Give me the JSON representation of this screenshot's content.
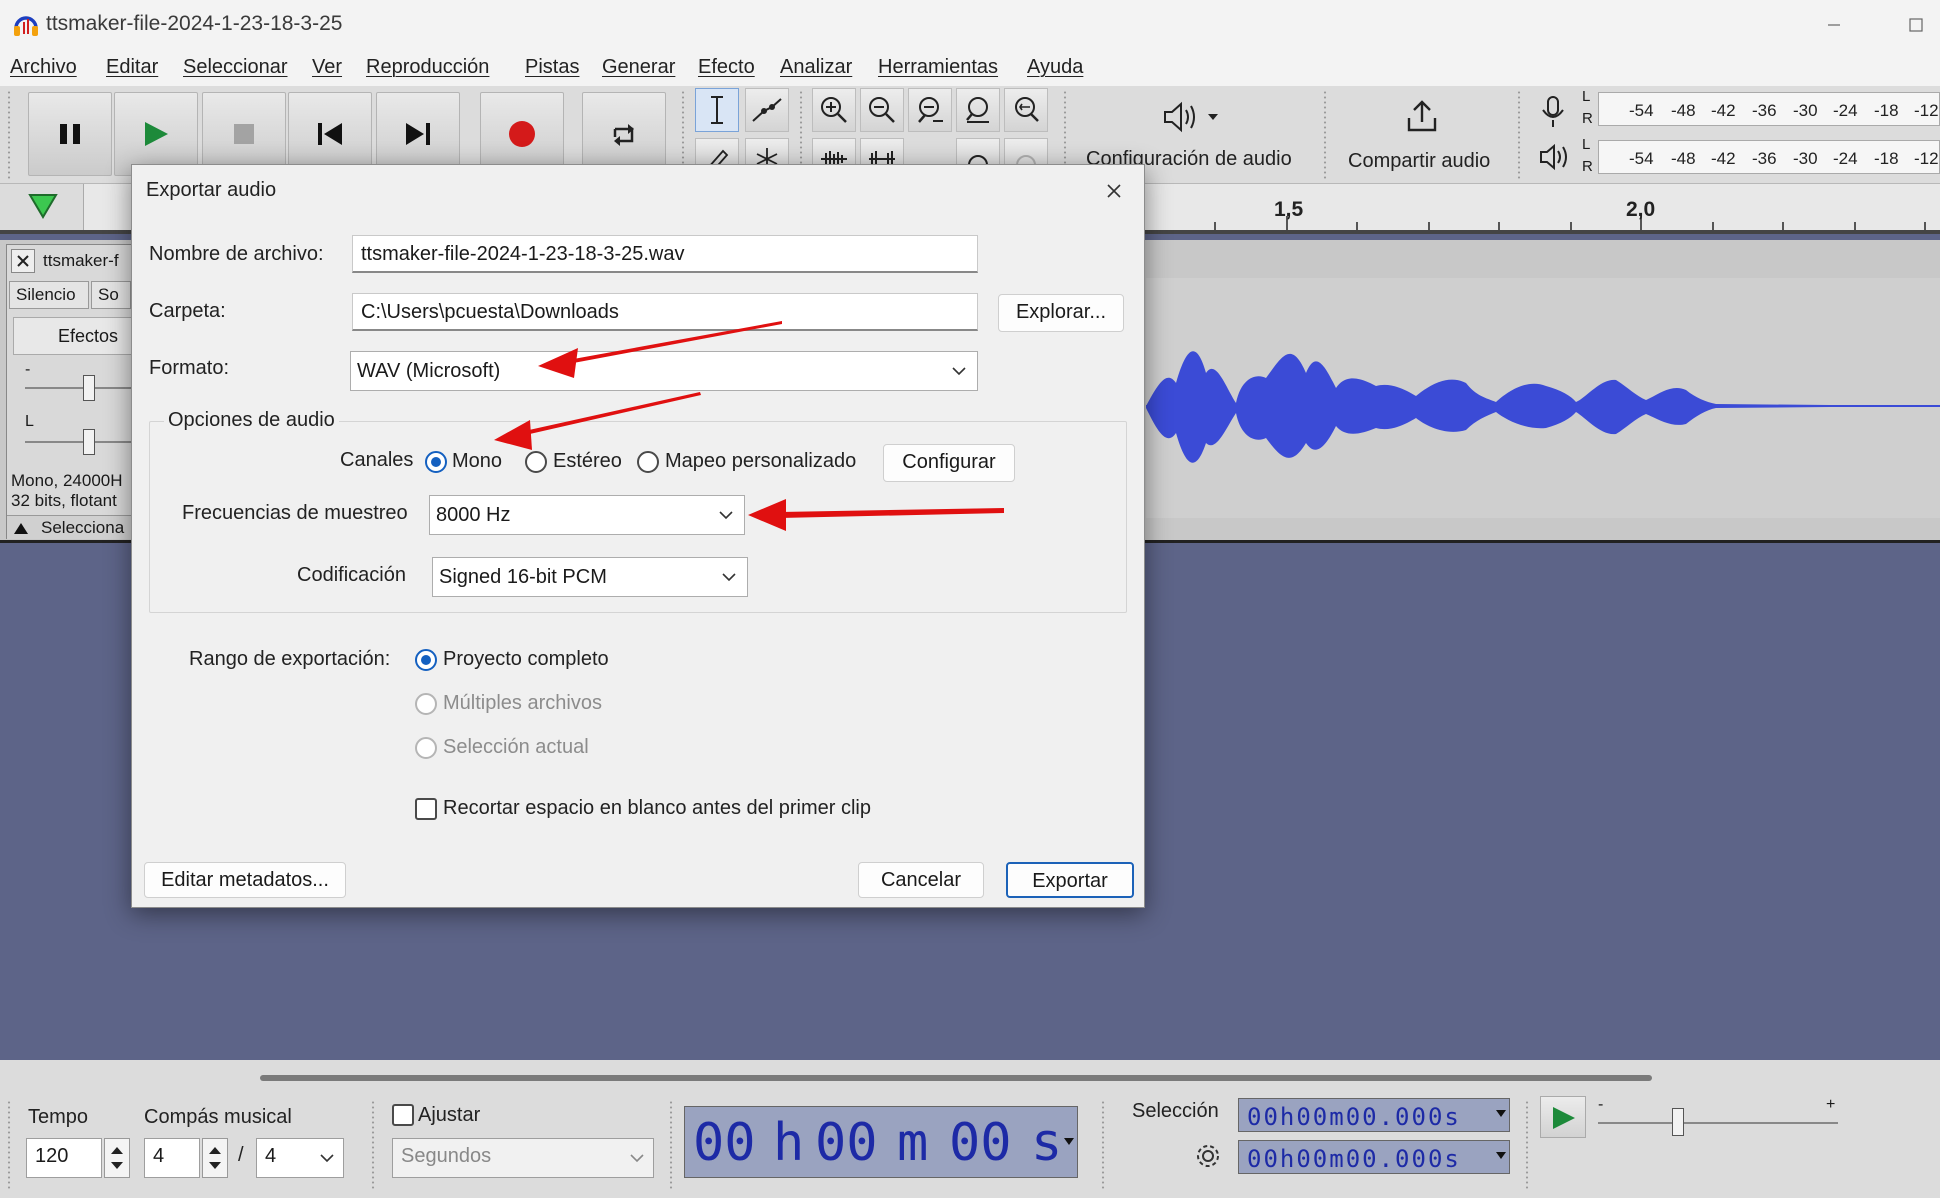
{
  "window": {
    "title": "ttsmaker-file-2024-1-23-18-3-25"
  },
  "menu": [
    "Archivo",
    "Editar",
    "Seleccionar",
    "Ver",
    "Reproducción",
    "Pistas",
    "Generar",
    "Efecto",
    "Analizar",
    "Herramientas",
    "Ayuda"
  ],
  "toolbar": {
    "audio_setup_label": "Configuración de audio",
    "share_label": "Compartir audio",
    "meter_channels": [
      "L",
      "R"
    ],
    "meter_scale": [
      "-54",
      "-48",
      "-42",
      "-36",
      "-30",
      "-24",
      "-18",
      "-12"
    ]
  },
  "timeline": {
    "labels": [
      "1,5",
      "2,0"
    ]
  },
  "track": {
    "name": "ttsmaker-f",
    "mute_label": "Silencio",
    "solo_label": "So",
    "effects_label": "Efectos",
    "gain_mark": "-",
    "pan_mark": "L",
    "info_line1": "Mono, 24000H",
    "info_line2": "32 bits, flotant",
    "select_label": "Selecciona"
  },
  "dialog": {
    "title": "Exportar audio",
    "filename_label": "Nombre de archivo:",
    "filename_value": "ttsmaker-file-2024-1-23-18-3-25.wav",
    "folder_label": "Carpeta:",
    "folder_value": "C:\\Users\\pcuesta\\Downloads",
    "browse_label": "Explorar...",
    "format_label": "Formato:",
    "format_value": "WAV (Microsoft)",
    "audio_options_label": "Opciones de audio",
    "channels_label": "Canales",
    "channel_options": [
      {
        "label": "Mono",
        "selected": true
      },
      {
        "label": "Estéreo",
        "selected": false
      },
      {
        "label": "Mapeo personalizado",
        "selected": false
      }
    ],
    "configure_label": "Configurar",
    "sample_rate_label": "Frecuencias de muestreo",
    "sample_rate_value": "8000 Hz",
    "encoding_label": "Codificación",
    "encoding_value": "Signed 16-bit PCM",
    "range_label": "Rango de exportación:",
    "range_options": [
      {
        "label": "Proyecto completo",
        "selected": true,
        "enabled": true
      },
      {
        "label": "Múltiples archivos",
        "selected": false,
        "enabled": false
      },
      {
        "label": "Selección actual",
        "selected": false,
        "enabled": false
      }
    ],
    "trim_label": "Recortar espacio en blanco antes del primer clip",
    "trim_checked": false,
    "metadata_label": "Editar metadatos...",
    "cancel_label": "Cancelar",
    "export_label": "Exportar"
  },
  "bottom": {
    "tempo_label": "Tempo",
    "tempo_value": "120",
    "time_sig_label": "Compás musical",
    "time_sig_num": "4",
    "time_sig_sep": "/",
    "time_sig_den": "4",
    "snap_label": "Ajustar",
    "snap_value": "Segundos",
    "time_display": [
      "00",
      "h",
      "00",
      "m",
      "00",
      "s"
    ],
    "selection_label": "Selección",
    "selection_start": "00h00m00.000s",
    "selection_end": "00h00m00.000s",
    "play_speed_minus": "-",
    "play_speed_plus": "+"
  },
  "colors": {
    "accent": "#1460c0",
    "waveform": "#3b4bd6",
    "annotation_arrow": "#e01010",
    "background": "#5d6488"
  }
}
